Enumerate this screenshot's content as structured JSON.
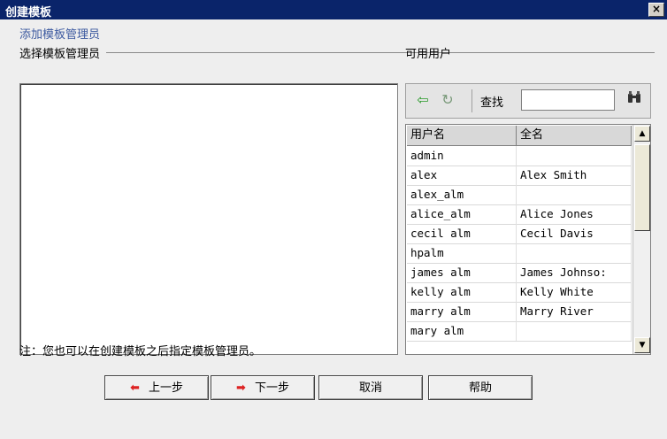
{
  "window": {
    "title": "创建模板",
    "close_glyph": "×"
  },
  "group": {
    "title": "添加模板管理员"
  },
  "left": {
    "label": "选择模板管理员"
  },
  "right": {
    "label": "可用用户",
    "toolbar": {
      "back_icon": "⇦",
      "refresh_icon": "↻",
      "find_label": "查找",
      "find_value": "",
      "binoculars_icon": "🔭"
    },
    "grid": {
      "columns": [
        "用户名",
        "全名"
      ],
      "rows": [
        [
          "admin",
          ""
        ],
        [
          "alex",
          "Alex Smith"
        ],
        [
          "alex_alm",
          ""
        ],
        [
          "alice_alm",
          "Alice Jones"
        ],
        [
          "cecil alm",
          "Cecil Davis"
        ],
        [
          "hpalm",
          ""
        ],
        [
          "james alm",
          "James Johnso:"
        ],
        [
          "kelly alm",
          "Kelly White"
        ],
        [
          "marry alm",
          "Marry River"
        ],
        [
          "mary alm",
          ""
        ]
      ]
    }
  },
  "note": "注：您也可以在创建模板之后指定模板管理员。",
  "buttons": {
    "prev": "上一步",
    "next": "下一步",
    "cancel": "取消",
    "help": "帮助",
    "prev_arrow": "⬅",
    "next_arrow": "➡"
  }
}
